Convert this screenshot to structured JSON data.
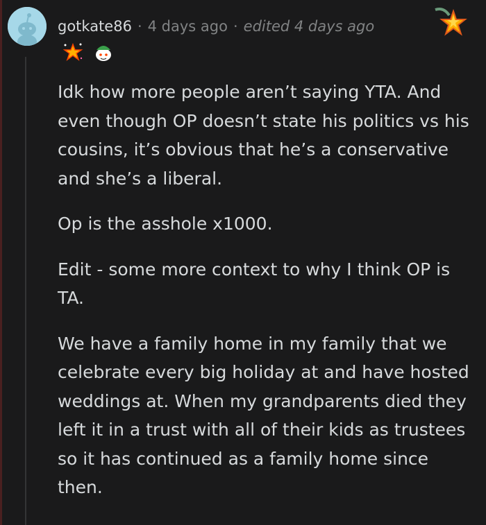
{
  "comment": {
    "username": "gotkate86",
    "separator": "·",
    "timestamp": "4 days ago",
    "edited": "edited 4 days ago",
    "awards": [
      "starstruck-award-icon",
      "snoo-elf-award-icon"
    ],
    "top_award": "star-award-icon",
    "paragraphs": [
      "Idk how more people aren’t saying YTA. And even though OP doesn’t state his politics vs his cousins, it’s obvious that he’s a conservative and she’s a liberal.",
      "Op is the asshole x1000.",
      "Edit - some more context to why I think OP is TA.",
      "We have a family home in my family that we celebrate every big holiday at and have hosted weddings at. When my grandparents died they left it in a trust with all of their kids as trustees so it has continued as a family home since then."
    ]
  },
  "colors": {
    "background": "#1a1a1b",
    "text": "#d7dadc",
    "meta": "#818384",
    "avatar_bg": "#a6d8e8"
  }
}
